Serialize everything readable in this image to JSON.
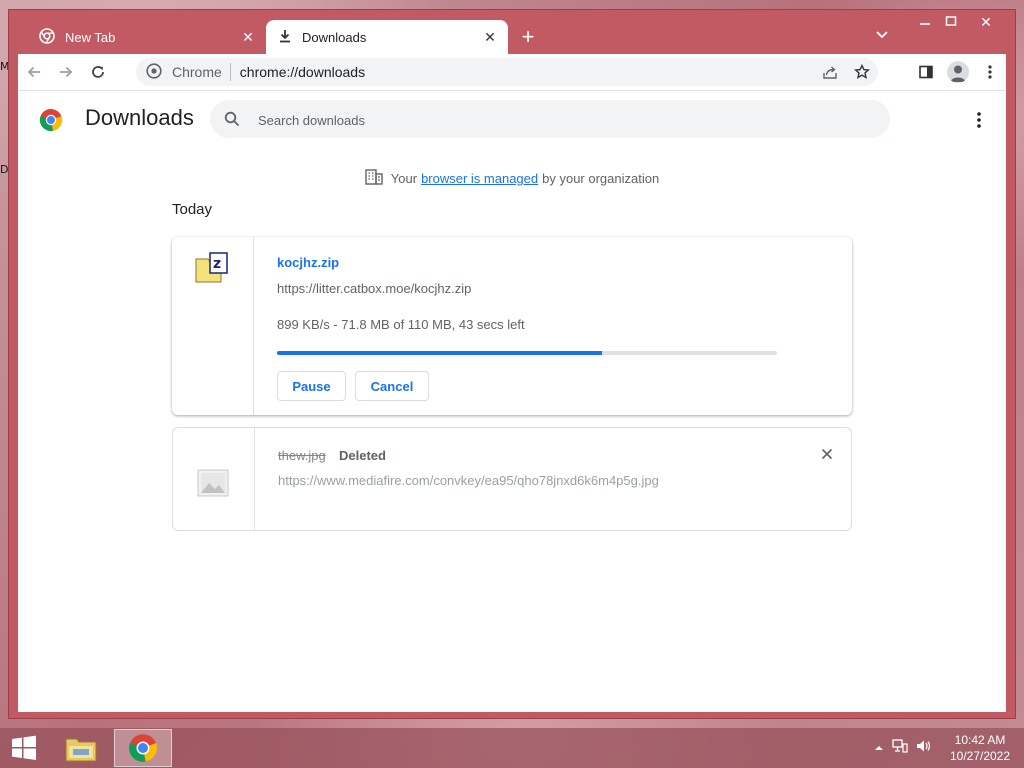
{
  "browser": {
    "tabs": [
      {
        "title": "New Tab",
        "icon": "chrome-icon",
        "active": false
      },
      {
        "title": "Downloads",
        "icon": "download-icon",
        "active": true
      }
    ],
    "toolbar": {
      "site_label": "Chrome",
      "url": "chrome://downloads"
    }
  },
  "page": {
    "title": "Downloads",
    "search_placeholder": "Search downloads",
    "managed_notice": {
      "prefix": "Your",
      "link": "browser is managed",
      "suffix": "by your organization"
    },
    "section_date": "Today",
    "downloads": [
      {
        "file_name": "kocjhz.zip",
        "url": "https://litter.catbox.moe/kocjhz.zip",
        "status": "899 KB/s - 71.8 MB of 110 MB, 43 secs left",
        "progress_fraction": 0.65,
        "pause_label": "Pause",
        "cancel_label": "Cancel"
      },
      {
        "file_name": "thew.jpg",
        "state": "Deleted",
        "url": "https://www.mediafire.com/convkey/ea95/qho78jnxd6k6m4p5g.jpg"
      }
    ]
  },
  "taskbar": {
    "clock_time": "10:42 AM",
    "clock_date": "10/27/2022"
  },
  "desktop": {
    "edge_letters": [
      "M",
      "D"
    ]
  },
  "colors": {
    "accent": "#1a73e8",
    "window_frame": "#c25a64"
  }
}
